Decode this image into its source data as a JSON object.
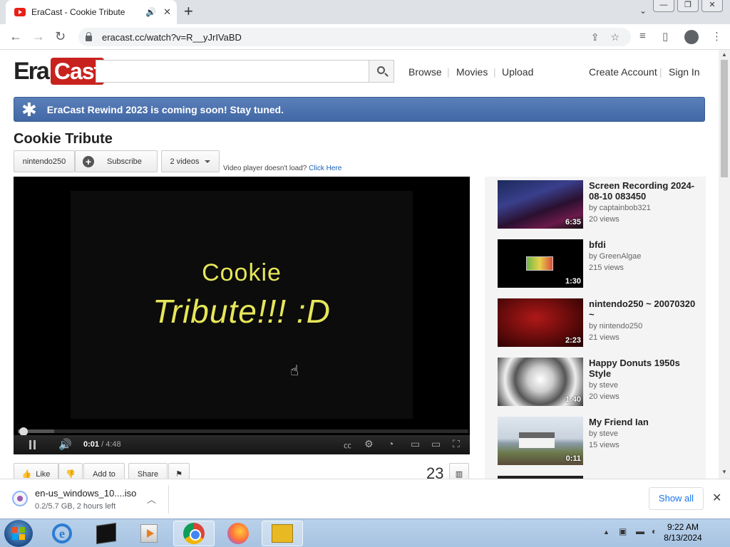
{
  "browser": {
    "tab_title": "EraCast - Cookie Tribute",
    "audio_glyph": "🔊",
    "close_glyph": "✕",
    "new_tab_glyph": "+",
    "tab_list_glyph": "⌄",
    "url": "eracast.cc/watch?v=R__yJrIVaBD",
    "window_buttons": [
      "—",
      "❐",
      "✕"
    ]
  },
  "site": {
    "logo_left": "Era",
    "logo_right": "Cast",
    "search_placeholder": "",
    "nav": [
      "Browse",
      "Movies",
      "Upload"
    ],
    "account": [
      "Create Account",
      "Sign In"
    ],
    "nav_separator": "|",
    "banner": "EraCast Rewind 2023 is coming soon! Stay tuned.",
    "banner_icon_glyph": "✱"
  },
  "video": {
    "title": "Cookie Tribute",
    "uploader": "nintendo250",
    "subscribe_label": "Subscribe",
    "videos_label": "2 videos",
    "not_loading_text": "Video player doesn't load?",
    "click_here": "Click Here",
    "frame_line1": "Cookie",
    "frame_line2": "Tribute!!!  :D",
    "time_current": "0:01",
    "time_total": "/ 4:48",
    "progress_fraction": 0.003,
    "buffered_fraction": 0.08,
    "like_label": "Like",
    "add_to_label": "Add to",
    "share_label": "Share",
    "view_count": "23"
  },
  "related": [
    {
      "title": "Screen Recording 2024-08-10 083450",
      "by": "by captainbob321",
      "views": "20 views",
      "duration": "6:35"
    },
    {
      "title": "bfdi",
      "by": "by GreenAlgae",
      "views": "215 views",
      "duration": "1:30"
    },
    {
      "title": "nintendo250 ~ 20070320 ~",
      "by": "by nintendo250",
      "views": "21 views",
      "duration": "2:23"
    },
    {
      "title": "Happy Donuts 1950s Style",
      "by": "by steve",
      "views": "20 views",
      "duration": "1:40"
    },
    {
      "title": "My Friend Ian",
      "by": "by steve",
      "views": "15 views",
      "duration": "0:11"
    }
  ],
  "download": {
    "file_name": "en-us_windows_10....iso",
    "status": "0.2/5.7 GB, 2 hours left",
    "show_all": "Show all"
  },
  "taskbar": {
    "time": "9:22 AM",
    "date": "8/13/2024"
  },
  "colors": {
    "brand_red": "#c8221e",
    "banner_blue": "#4268a6",
    "link_blue": "#1a5fb4",
    "frame_text_yellow": "#e6e65a"
  }
}
